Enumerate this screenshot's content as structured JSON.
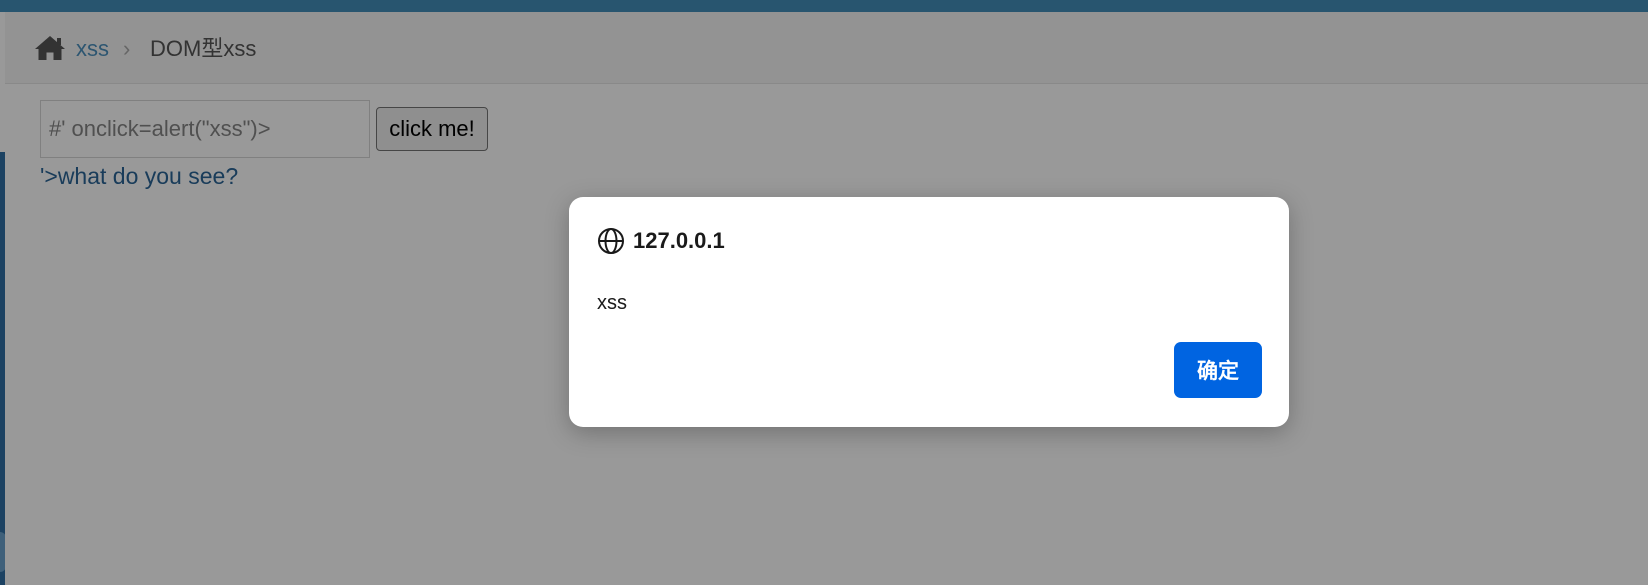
{
  "breadcrumb": {
    "home_link": "xss",
    "separator": "›",
    "current": "DOM型xss"
  },
  "form": {
    "input_value": "#' onclick=alert(\"xss\")>",
    "button_label": "click me!"
  },
  "result": {
    "link_text": "'>what do you see?"
  },
  "alert_dialog": {
    "origin": "127.0.0.1",
    "message": "xss",
    "ok_label": "确定",
    "icon": "globe-icon"
  },
  "colors": {
    "topbar": "#438eb9",
    "link": "#4c8fbd",
    "ok_button": "#0064e1"
  }
}
